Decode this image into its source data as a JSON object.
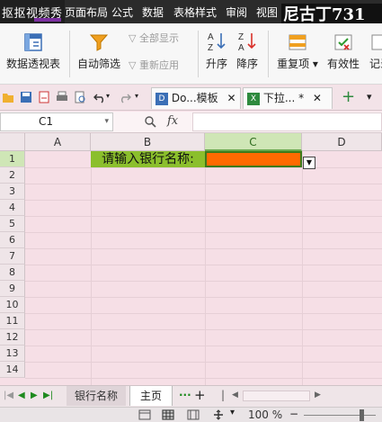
{
  "ribbon_tabs": {
    "overlay_text": "抠抠视频秀",
    "page_layout": "页面布局",
    "formulas": "公式",
    "data": "数据",
    "table_style": "表格样式",
    "review": "审阅",
    "view": "视图",
    "watermark": "尼古丁731"
  },
  "ribbon": {
    "pivot_table": "数据透视表",
    "auto_filter": "自动筛选",
    "show_all": "全部显示",
    "reapply": "重新应用",
    "sort_asc": "升序",
    "sort_desc": "降序",
    "duplicates": "重复项 ▾",
    "validity": "有效性",
    "record": "记录"
  },
  "doc_tabs": [
    {
      "label": "Do...模板",
      "close": "✕"
    },
    {
      "label": "下拉... *",
      "close": "✕"
    }
  ],
  "formula_bar": {
    "name_box": "C1",
    "fx": "fx",
    "formula": ""
  },
  "columns": [
    "A",
    "B",
    "C",
    "D"
  ],
  "rows": [
    "1",
    "2",
    "3",
    "4",
    "5",
    "6",
    "7",
    "8",
    "9",
    "10",
    "11",
    "12",
    "13",
    "14"
  ],
  "cells": {
    "B1": "请输入银行名称:",
    "C1": ""
  },
  "sheets": {
    "tab1": "银行名称",
    "tab2": "主页",
    "more": "···",
    "add": "+"
  },
  "status": {
    "zoom": "100 %"
  },
  "colors": {
    "accent_green": "#8bbf2c",
    "selection_orange": "#ff6a00",
    "grid_bg": "#f6dfe6"
  }
}
